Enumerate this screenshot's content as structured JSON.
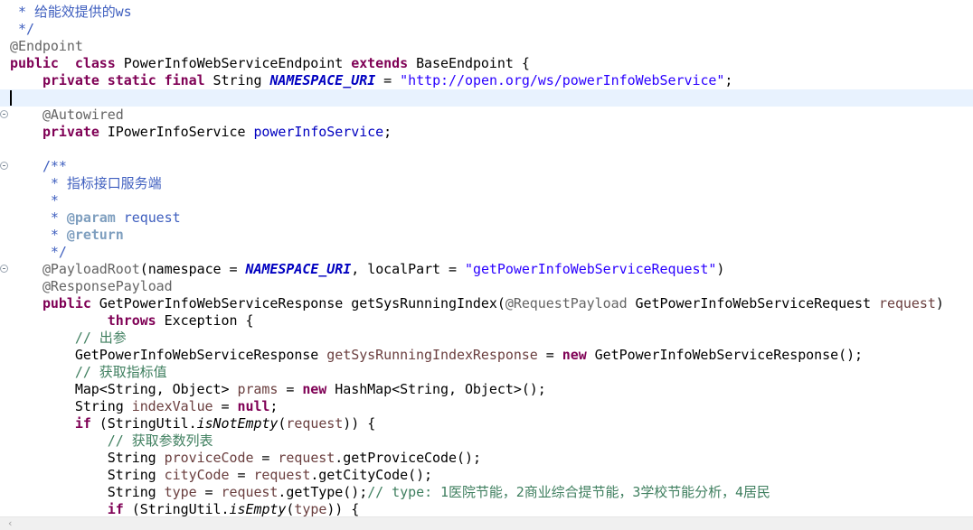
{
  "editor": {
    "current_line": 6,
    "fold_lines": [
      7,
      10,
      16
    ],
    "lines": [
      [
        [
          "jd",
          " * 给能效提供的ws"
        ]
      ],
      [
        [
          "jd",
          " */"
        ]
      ],
      [
        [
          "ann",
          "@Endpoint"
        ]
      ],
      [
        [
          "kw",
          "public"
        ],
        [
          "",
          "  "
        ],
        [
          "kw",
          "class"
        ],
        [
          "",
          " PowerInfoWebServiceEndpoint "
        ],
        [
          "kw",
          "extends"
        ],
        [
          "",
          " BaseEndpoint {"
        ]
      ],
      [
        [
          "",
          "    "
        ],
        [
          "kw",
          "private"
        ],
        [
          "",
          " "
        ],
        [
          "kw",
          "static"
        ],
        [
          "",
          " "
        ],
        [
          "kw",
          "final"
        ],
        [
          "",
          " String "
        ],
        [
          "sfld",
          "NAMESPACE_URI"
        ],
        [
          "",
          " = "
        ],
        [
          "str",
          "\"http://open.org/ws/powerInfoWebService\""
        ],
        [
          "",
          ";"
        ]
      ],
      [],
      [
        [
          "",
          "    "
        ],
        [
          "ann",
          "@Autowired"
        ]
      ],
      [
        [
          "",
          "    "
        ],
        [
          "kw",
          "private"
        ],
        [
          "",
          " IPowerInfoService "
        ],
        [
          "fld",
          "powerInfoService"
        ],
        [
          "",
          ";"
        ]
      ],
      [],
      [
        [
          "",
          "    "
        ],
        [
          "jd",
          "/**"
        ]
      ],
      [
        [
          "",
          "     "
        ],
        [
          "jd",
          "* 指标接口服务端"
        ]
      ],
      [
        [
          "",
          "     "
        ],
        [
          "jd",
          "*"
        ]
      ],
      [
        [
          "",
          "     "
        ],
        [
          "jd",
          "* "
        ],
        [
          "jtag",
          "@param"
        ],
        [
          "jd",
          " request"
        ]
      ],
      [
        [
          "",
          "     "
        ],
        [
          "jd",
          "* "
        ],
        [
          "jtag",
          "@return"
        ]
      ],
      [
        [
          "",
          "     "
        ],
        [
          "jd",
          "*/"
        ]
      ],
      [
        [
          "",
          "    "
        ],
        [
          "ann",
          "@PayloadRoot"
        ],
        [
          "",
          "(namespace = "
        ],
        [
          "sfld",
          "NAMESPACE_URI"
        ],
        [
          "",
          ", localPart = "
        ],
        [
          "str",
          "\"getPowerInfoWebServiceRequest\""
        ],
        [
          "",
          ")"
        ]
      ],
      [
        [
          "",
          "    "
        ],
        [
          "ann",
          "@ResponsePayload"
        ]
      ],
      [
        [
          "",
          "    "
        ],
        [
          "kw",
          "public"
        ],
        [
          "",
          " GetPowerInfoWebServiceResponse getSysRunningIndex("
        ],
        [
          "ann",
          "@RequestPayload"
        ],
        [
          "",
          " GetPowerInfoWebServiceRequest "
        ],
        [
          "var",
          "request"
        ],
        [
          "",
          ")"
        ]
      ],
      [
        [
          "",
          "            "
        ],
        [
          "kw",
          "throws"
        ],
        [
          "",
          " Exception {"
        ]
      ],
      [
        [
          "",
          "        "
        ],
        [
          "cm",
          "// 出参"
        ]
      ],
      [
        [
          "",
          "        GetPowerInfoWebServiceResponse "
        ],
        [
          "var",
          "getSysRunningIndexResponse"
        ],
        [
          "",
          " = "
        ],
        [
          "kw",
          "new"
        ],
        [
          "",
          " GetPowerInfoWebServiceResponse();"
        ]
      ],
      [
        [
          "",
          "        "
        ],
        [
          "cm",
          "// 获取指标值"
        ]
      ],
      [
        [
          "",
          "        Map<String, Object> "
        ],
        [
          "var",
          "prams"
        ],
        [
          "",
          " = "
        ],
        [
          "kw",
          "new"
        ],
        [
          "",
          " HashMap<String, Object>();"
        ]
      ],
      [
        [
          "",
          "        String "
        ],
        [
          "var",
          "indexValue"
        ],
        [
          "",
          " = "
        ],
        [
          "kw",
          "null"
        ],
        [
          "",
          ";"
        ]
      ],
      [
        [
          "",
          "        "
        ],
        [
          "kw",
          "if"
        ],
        [
          "",
          " (StringUtil."
        ],
        [
          "smeth",
          "isNotEmpty"
        ],
        [
          "",
          "("
        ],
        [
          "var",
          "request"
        ],
        [
          "",
          ")) {"
        ]
      ],
      [
        [
          "",
          "            "
        ],
        [
          "cm",
          "// 获取参数列表"
        ]
      ],
      [
        [
          "",
          "            String "
        ],
        [
          "var",
          "proviceCode"
        ],
        [
          "",
          " = "
        ],
        [
          "var",
          "request"
        ],
        [
          "",
          ".getProviceCode();"
        ]
      ],
      [
        [
          "",
          "            String "
        ],
        [
          "var",
          "cityCode"
        ],
        [
          "",
          " = "
        ],
        [
          "var",
          "request"
        ],
        [
          "",
          ".getCityCode();"
        ]
      ],
      [
        [
          "",
          "            String "
        ],
        [
          "var",
          "type"
        ],
        [
          "",
          " = "
        ],
        [
          "var",
          "request"
        ],
        [
          "",
          ".getType();"
        ],
        [
          "cm",
          "// type: 1医院节能，2商业综合提节能，3学校节能分析，4居民"
        ]
      ],
      [
        [
          "",
          "            "
        ],
        [
          "kw",
          "if"
        ],
        [
          "",
          " (StringUtil."
        ],
        [
          "smeth",
          "isEmpty"
        ],
        [
          "",
          "("
        ],
        [
          "var",
          "type"
        ],
        [
          "",
          ")) {"
        ]
      ]
    ]
  },
  "scrollbar": {
    "left_arrow_icon": "chevron-left-icon",
    "left_arrow": "‹"
  }
}
